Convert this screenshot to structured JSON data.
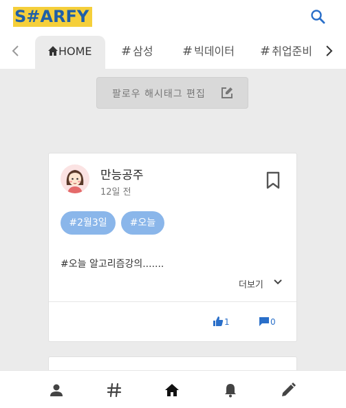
{
  "header": {
    "logo_text": "S#ARFY",
    "brand_colors": {
      "logo_bg": "#f5cf3a",
      "logo_text": "#1f5fa8",
      "accent": "#2a6fc9"
    },
    "search_icon": "search-icon"
  },
  "tabs": {
    "prev_icon": "chevron-left-icon",
    "next_icon": "chevron-right-icon",
    "items": [
      {
        "label": "HOME",
        "icon": "home-icon",
        "active": true
      },
      {
        "label": "삼성",
        "prefix": "#"
      },
      {
        "label": "빅데이터",
        "prefix": "#"
      },
      {
        "label": "취업준비",
        "prefix": "#"
      }
    ]
  },
  "follow_button": {
    "label": "팔로우 해시태그 편집",
    "icon": "edit-icon"
  },
  "post": {
    "author": "만능공주",
    "time": "12일 전",
    "tags": [
      "#2월3일",
      "#오늘"
    ],
    "content": "#오늘 알고리즘강의.......",
    "more_label": "더보기",
    "likes": "1",
    "comments": "0"
  },
  "bottom_nav": {
    "items": [
      "user-icon",
      "hashtag-icon",
      "home-icon",
      "bell-icon",
      "pencil-icon"
    ]
  }
}
